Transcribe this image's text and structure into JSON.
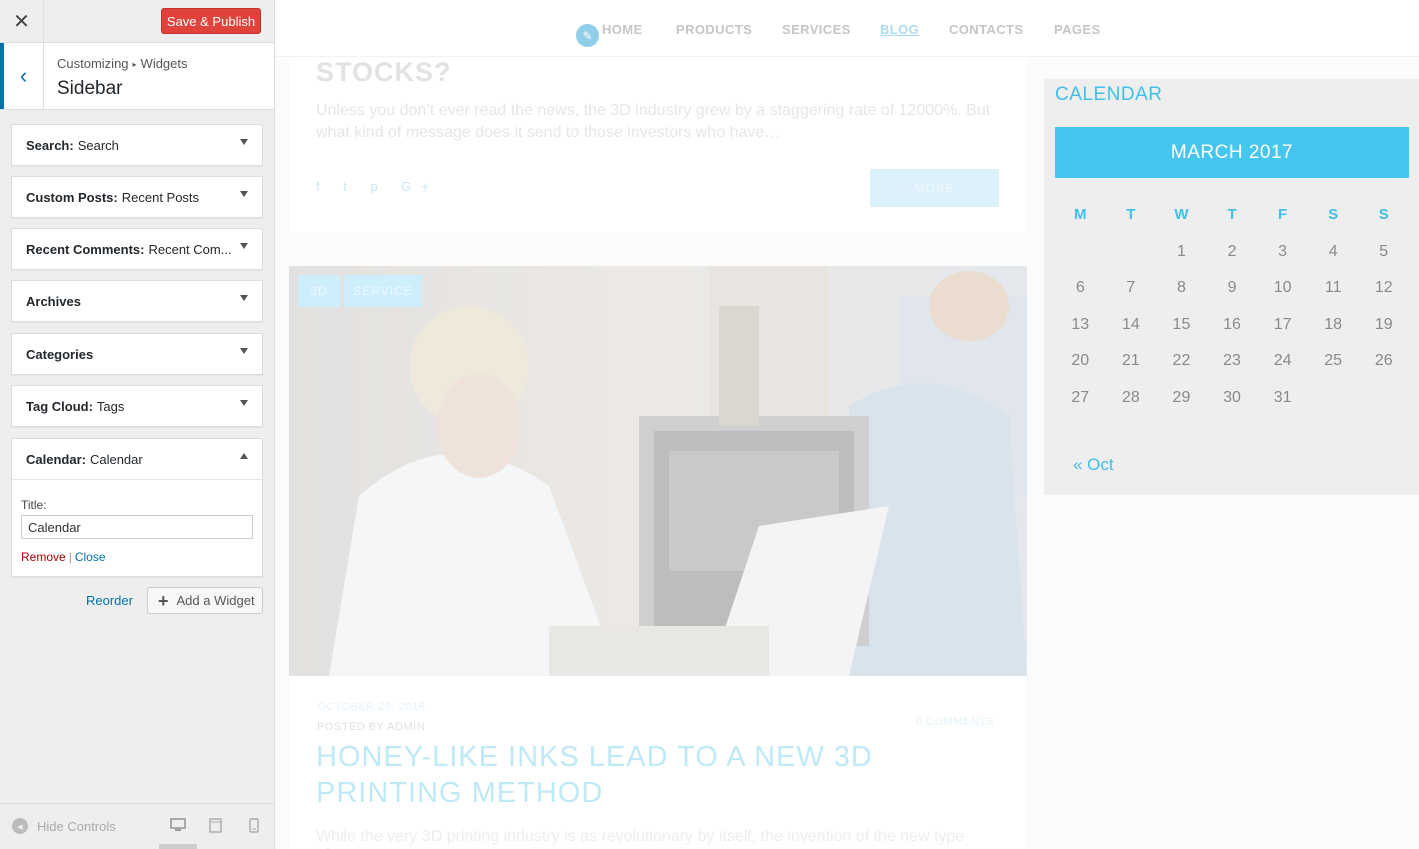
{
  "customizer": {
    "close_icon": "close-icon",
    "save_label": "Save & Publish",
    "breadcrumb": {
      "root": "Customizing",
      "section": "Widgets"
    },
    "section_title": "Sidebar",
    "widgets": [
      {
        "type": "Search:",
        "title": "Search"
      },
      {
        "type": "Custom Posts:",
        "title": "Recent Posts"
      },
      {
        "type": "Recent Comments:",
        "title": "Recent Com..."
      },
      {
        "type": "Archives",
        "title": ""
      },
      {
        "type": "Categories",
        "title": ""
      },
      {
        "type": "Tag Cloud:",
        "title": "Tags"
      },
      {
        "type": "Calendar:",
        "title": "Calendar",
        "expanded": true
      }
    ],
    "calendar_form": {
      "title_label": "Title:",
      "title_value": "Calendar",
      "remove_label": "Remove",
      "separator": "|",
      "close_label": "Close"
    },
    "reorder_label": "Reorder",
    "add_widget_label": "Add a Widget",
    "hide_controls_label": "Hide Controls",
    "accent_color": "#0073aa",
    "save_color": "#e0433b"
  },
  "preview": {
    "nav": [
      "HOME",
      "PRODUCTS",
      "SERVICES",
      "BLOG",
      "CONTACTS",
      "PAGES"
    ],
    "nav_active": "BLOG",
    "post1": {
      "title": "STOCKS?",
      "excerpt": "Unless you don’t ever read the news, the 3D industry grew by a staggering rate of 12000%. But what kind of message does it send to those investors who have…",
      "social": "f t p G+",
      "more_label": "MORE"
    },
    "post2": {
      "tags": [
        "3D",
        "SERVICE"
      ],
      "date": "OCTOBER 25, 2016",
      "author": "POSTED BY ADMIN",
      "comments": "0 COMMENTS",
      "title": "HONEY-LIKE INKS LEAD TO A NEW 3D PRINTING METHOD",
      "excerpt": "While the very 3D printing industry is as revolutionary by itself, the invention of the new type of…"
    },
    "calendar": {
      "heading": "CALENDAR",
      "month": "MARCH 2017",
      "weekdays": [
        "M",
        "T",
        "W",
        "T",
        "F",
        "S",
        "S"
      ],
      "weeks": [
        [
          "",
          "",
          "1",
          "2",
          "3",
          "4",
          "5"
        ],
        [
          "6",
          "7",
          "8",
          "9",
          "10",
          "11",
          "12"
        ],
        [
          "13",
          "14",
          "15",
          "16",
          "17",
          "18",
          "19"
        ],
        [
          "20",
          "21",
          "22",
          "23",
          "24",
          "25",
          "26"
        ],
        [
          "27",
          "28",
          "29",
          "30",
          "31",
          "",
          ""
        ]
      ],
      "prev_link": "« Oct",
      "accent_color": "#45c6ee"
    }
  }
}
